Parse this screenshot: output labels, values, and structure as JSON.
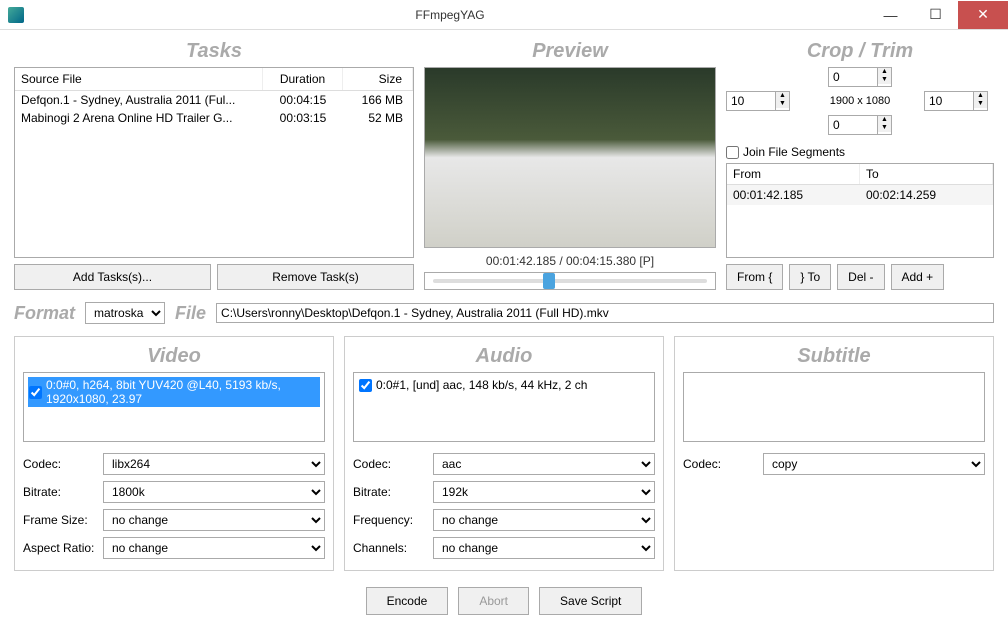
{
  "window": {
    "title": "FFmpegYAG"
  },
  "sections": {
    "tasks": "Tasks",
    "preview": "Preview",
    "crop": "Crop / Trim",
    "video": "Video",
    "audio": "Audio",
    "subtitle": "Subtitle"
  },
  "tasks": {
    "headers": {
      "source": "Source File",
      "duration": "Duration",
      "size": "Size"
    },
    "rows": [
      {
        "source": "Defqon.1 - Sydney, Australia 2011 (Ful...",
        "duration": "00:04:15",
        "size": "166 MB"
      },
      {
        "source": "Mabinogi 2 Arena Online HD Trailer G...",
        "duration": "00:03:15",
        "size": "52 MB"
      }
    ],
    "add_label": "Add Tasks(s)...",
    "remove_label": "Remove Task(s)"
  },
  "preview": {
    "time": "00:01:42.185 / 00:04:15.380 [P]"
  },
  "crop": {
    "top": "0",
    "left": "10",
    "right": "10",
    "bottom": "0",
    "center": "1900 x 1080",
    "join_label": "Join File Segments",
    "seg_headers": {
      "from": "From",
      "to": "To"
    },
    "segments": [
      {
        "from": "00:01:42.185",
        "to": "00:02:14.259"
      }
    ],
    "btn_from": "From {",
    "btn_to": "} To",
    "btn_del": "Del -",
    "btn_add": "Add +"
  },
  "format": {
    "fmt_label": "Format",
    "fmt_value": "matroska",
    "file_label": "File",
    "file_value": "C:\\Users\\ronny\\Desktop\\Defqon.1 - Sydney, Australia 2011 (Full HD).mkv"
  },
  "video": {
    "stream": "0:0#0, h264, 8bit YUV420 @L40, 5193 kb/s, 1920x1080, 23.97",
    "codec_label": "Codec:",
    "codec_value": "libx264",
    "bitrate_label": "Bitrate:",
    "bitrate_value": "1800k",
    "framesize_label": "Frame Size:",
    "framesize_value": "no change",
    "aspect_label": "Aspect Ratio:",
    "aspect_value": "no change"
  },
  "audio": {
    "stream": "0:0#1, [und] aac, 148 kb/s, 44 kHz, 2 ch",
    "codec_label": "Codec:",
    "codec_value": "aac",
    "bitrate_label": "Bitrate:",
    "bitrate_value": "192k",
    "freq_label": "Frequency:",
    "freq_value": "no change",
    "channels_label": "Channels:",
    "channels_value": "no change"
  },
  "subtitle": {
    "codec_label": "Codec:",
    "codec_value": "copy"
  },
  "bottom": {
    "encode": "Encode",
    "abort": "Abort",
    "save": "Save Script"
  }
}
